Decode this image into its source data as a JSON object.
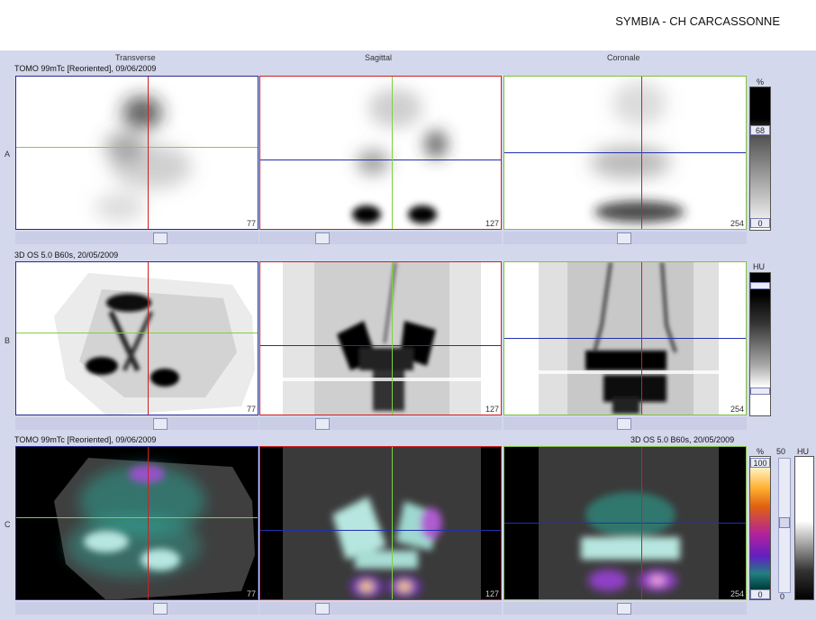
{
  "header": {
    "title": "SYMBIA - CH CARCASSONNE"
  },
  "columns": {
    "transverse": "Transverse",
    "sagittal": "Sagittal",
    "coronal": "Coronale"
  },
  "rows": {
    "a": {
      "label": "A",
      "info": "TOMO 99mTc [Reoriented], 09/06/2009",
      "numbers": [
        "77",
        "127",
        "254"
      ]
    },
    "b": {
      "label": "B",
      "info": "3D  OS  5.0  B60s, 20/05/2009",
      "numbers": [
        "77",
        "127",
        "254"
      ]
    },
    "c": {
      "label": "C",
      "info_left": "TOMO 99mTc [Reoriented], 09/06/2009",
      "info_right": "3D  OS  5.0  B60s, 20/05/2009",
      "numbers": [
        "77",
        "127",
        "254"
      ]
    }
  },
  "colorbars": {
    "a": {
      "unit": "%",
      "top_value": "68",
      "bottom_value": "0"
    },
    "b": {
      "unit": "HU"
    },
    "c": {
      "unit_pct": "%",
      "top_value": "100",
      "bottom_value": "0",
      "unit_hu": "HU",
      "hu_scale_top": "50",
      "hu_scale_bottom": "0"
    }
  },
  "colors": {
    "workspace": "#d4d8ec",
    "transverse_border": "#2a2a90",
    "sagittal_border": "#cc2020",
    "coronal_border": "#80c040",
    "crosshair_green": "#80d040",
    "crosshair_red": "#d02020",
    "crosshair_blue": "#2030b0"
  }
}
